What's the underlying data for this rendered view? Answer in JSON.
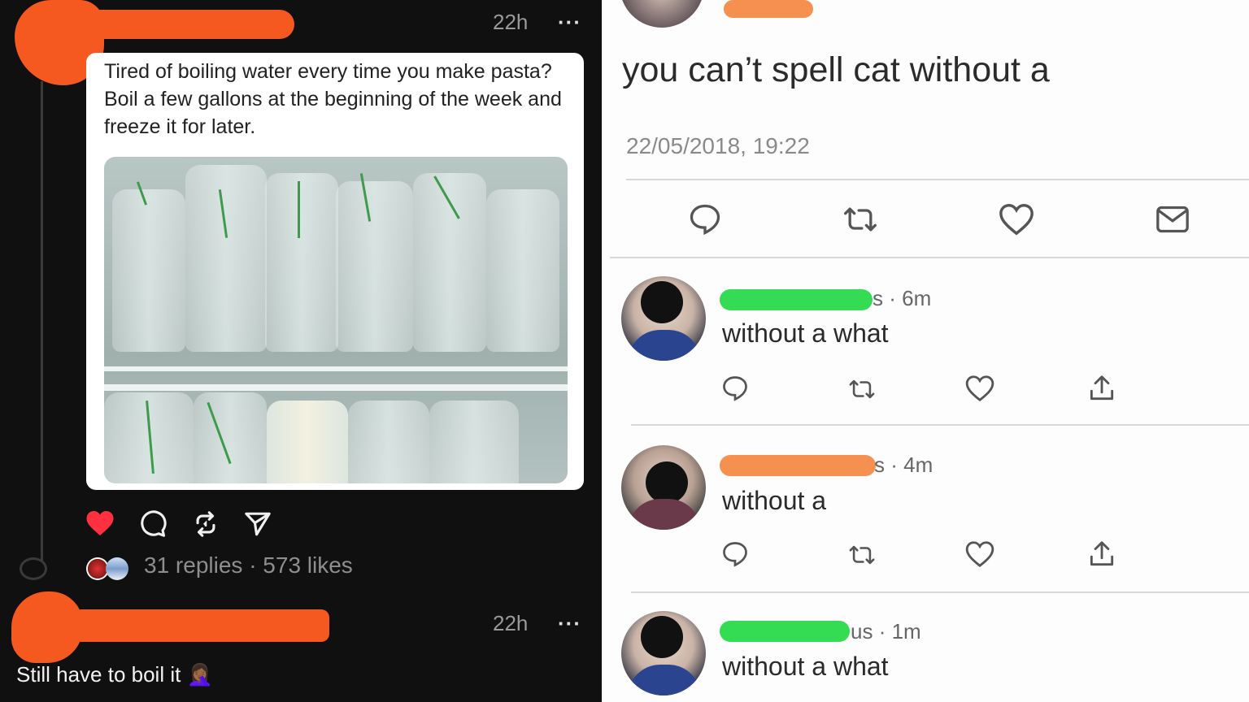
{
  "left_post": {
    "time": "22h",
    "more": "···",
    "card_text": "Tired of boiling water every time you make pasta? Boil a few gallons at the beginning of the week and freeze it for later.",
    "stats": {
      "replies": "31 replies",
      "separator": "·",
      "likes": "573 likes"
    },
    "icons": [
      "heart-icon",
      "comment-icon",
      "repost-icon",
      "share-icon"
    ],
    "colors": {
      "background": "#101010",
      "like": "#ff3040",
      "redaction": "#f5591f"
    }
  },
  "left_reply": {
    "time": "22h",
    "more": "···",
    "text": "Still have to boil it",
    "emoji": "🤦🏾‍♀️"
  },
  "right_thread": {
    "main_tweet": "you can’t spell cat without a",
    "timestamp": "22/05/2018, 19:22",
    "main_actions": [
      "reply-icon",
      "retweet-icon",
      "like-icon",
      "message-icon"
    ],
    "replies": [
      {
        "handle_end": "s",
        "time": "· 6m",
        "text": "without a what"
      },
      {
        "handle_end": "s",
        "time": "· 4m",
        "text": "without a"
      },
      {
        "handle_end": "us",
        "time": "· 1m",
        "text": "without a what"
      }
    ],
    "colors": {
      "green_redaction": "#33dc53",
      "orange_redaction": "#f59050"
    }
  }
}
